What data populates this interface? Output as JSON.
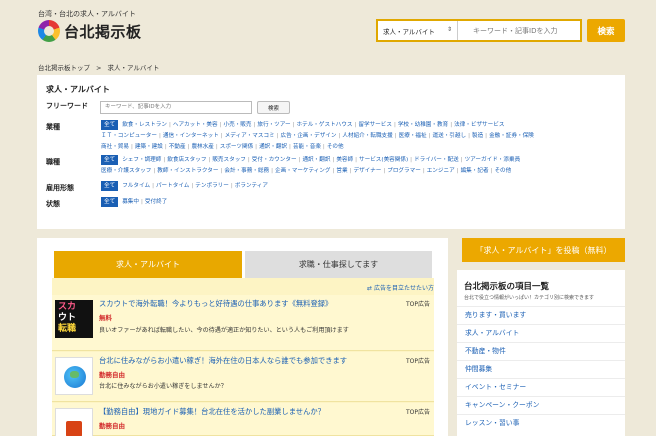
{
  "header": {
    "tagline": "台湾・台北の求人・アルバイト",
    "logo_text": "台北掲示板",
    "search_category": "求人・アルバイト",
    "search_placeholder": "キーワード・記事IDを入力",
    "search_button": "検索"
  },
  "breadcrumb": {
    "home": "台北掲示板トップ",
    "separator": ">",
    "current": "求人・アルバイト"
  },
  "filter": {
    "title": "求人・アルバイト",
    "freeword_label": "フリーワード",
    "freeword_placeholder": "キーワード、記事IDを入力",
    "freeword_button": "検索",
    "all_label": "全て",
    "industry_label": "業種",
    "industry_lines": [
      [
        "飲食・レストラン",
        "ヘアカット・美容",
        "小売・販売",
        "旅行・ツアー",
        "ホテル・ゲストハウス",
        "留学サービス",
        "学校・幼稚園・教育",
        "法律・ビザサービス"
      ],
      [
        "ＩＴ・コンピューター",
        "通信・インターネット",
        "メディア・マスコミ",
        "広告・企画・デザイン",
        "人材紹介・転職支援",
        "医療・福祉",
        "運送・引越し",
        "製造",
        "金融・証券・保険"
      ],
      [
        "商社・貿易",
        "建築・建設",
        "不動産",
        "農林水産",
        "スポーツ関係",
        "通訳・翻訳",
        "芸能・音楽",
        "その他"
      ]
    ],
    "job_label": "職種",
    "job_lines": [
      [
        "シェフ・調理師",
        "飲食店スタッフ",
        "販売スタッフ",
        "受付・カウンター",
        "通訳・翻訳",
        "美容師",
        "サービス(美容関係)",
        "ドライバー・配送",
        "ツアーガイド・添乗員"
      ],
      [
        "医療・介護スタッフ",
        "教師・インストラクター",
        "会計・事務・総務",
        "企画・マーケティング",
        "営業",
        "デザイナー",
        "プログラマー",
        "エンジニア",
        "編集・記者",
        "その他"
      ]
    ],
    "employment_label": "雇用形態",
    "employment_items": [
      "フルタイム",
      "パートタイム",
      "テンポラリー",
      "ボランティア"
    ],
    "status_label": "状態",
    "status_items": [
      "募集中",
      "受付終了"
    ]
  },
  "main": {
    "tab_active": "求人・アルバイト",
    "tab_inactive": "求職・仕事探してます",
    "ad_link": "広告を目立たせたい方",
    "items": [
      {
        "title": "スカウトで海外転職！今よりもっと好待遇の仕事あります《無料登録》",
        "tag": "TOP広告",
        "pay": "無料",
        "desc": "良いオファーがあれば転職したい、今の待遇が適正か知りたい、という人もご利用頂けます",
        "thumb_text": [
          "スカ",
          "ウト",
          "転職"
        ]
      },
      {
        "title": "台北に住みながらお小遣い稼ぎ！海外在住の日本人なら誰でも参加できます",
        "tag": "TOP広告",
        "pay": "勤務自由",
        "desc": "台北に住みながらお小遣い稼ぎをしませんか？"
      },
      {
        "title": "【勤務自由】現地ガイド募集！台北在住を活かした副業しませんか？",
        "tag": "TOP広告",
        "pay": "勤務自由",
        "desc": ""
      }
    ]
  },
  "sidebar": {
    "post_button": "「求人・アルバイト」を投稿（無料）",
    "title": "台北掲示板の項目一覧",
    "subtitle": "台北で役立つ情報がいっぱい！カテゴリ別に検索できます",
    "items": [
      "売ります・買います",
      "求人・アルバイト",
      "不動産・物件",
      "仲間募集",
      "イベント・セミナー",
      "キャンペーン・クーポン",
      "レッスン・習い事"
    ]
  },
  "colors": {
    "accent": "#eca800",
    "link": "#1a5fb4",
    "background": "#eee9d9"
  }
}
